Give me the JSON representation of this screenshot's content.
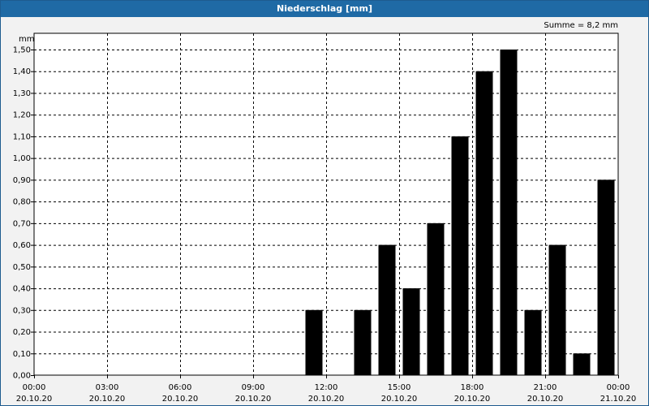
{
  "window": {
    "title": "Niederschlag [mm]"
  },
  "summary": {
    "text": "Summe = 8,2 mm"
  },
  "chart_data": {
    "type": "bar",
    "title": "Niederschlag [mm]",
    "ylabel": "mm",
    "xlabel": "",
    "ylim": [
      0,
      1.5
    ],
    "yticks": [
      0,
      0.1,
      0.2,
      0.3,
      0.4,
      0.5,
      0.6,
      0.7,
      0.8,
      0.9,
      1.0,
      1.1,
      1.2,
      1.3,
      1.4,
      1.5
    ],
    "ytick_labels": [
      "0,00",
      "0,10",
      "0,20",
      "0,30",
      "0,40",
      "0,50",
      "0,60",
      "0,70",
      "0,80",
      "0,90",
      "1,00",
      "1,10",
      "1,20",
      "1,30",
      "1,40",
      "1,50"
    ],
    "xlim_hours": [
      0,
      24
    ],
    "xticks": [
      {
        "hour": 0,
        "time": "00:00",
        "date": "20.10.20"
      },
      {
        "hour": 3,
        "time": "03:00",
        "date": "20.10.20"
      },
      {
        "hour": 6,
        "time": "06:00",
        "date": "20.10.20"
      },
      {
        "hour": 9,
        "time": "09:00",
        "date": "20.10.20"
      },
      {
        "hour": 12,
        "time": "12:00",
        "date": "20.10.20"
      },
      {
        "hour": 15,
        "time": "15:00",
        "date": "20.10.20"
      },
      {
        "hour": 18,
        "time": "18:00",
        "date": "20.10.20"
      },
      {
        "hour": 21,
        "time": "21:00",
        "date": "20.10.20"
      },
      {
        "hour": 24,
        "time": "00:00",
        "date": "21.10.20"
      }
    ],
    "bars": [
      {
        "hour": 11.5,
        "value": 0.3
      },
      {
        "hour": 13.5,
        "value": 0.3
      },
      {
        "hour": 14.5,
        "value": 0.6
      },
      {
        "hour": 15.5,
        "value": 0.4
      },
      {
        "hour": 16.5,
        "value": 0.7
      },
      {
        "hour": 17.5,
        "value": 1.1
      },
      {
        "hour": 18.5,
        "value": 1.4
      },
      {
        "hour": 19.5,
        "value": 1.5
      },
      {
        "hour": 20.5,
        "value": 0.3
      },
      {
        "hour": 21.5,
        "value": 0.6
      },
      {
        "hour": 22.5,
        "value": 0.1
      },
      {
        "hour": 23.5,
        "value": 0.9
      }
    ],
    "grid": true,
    "bar_color": "#000000",
    "grid_color": "#000000"
  }
}
